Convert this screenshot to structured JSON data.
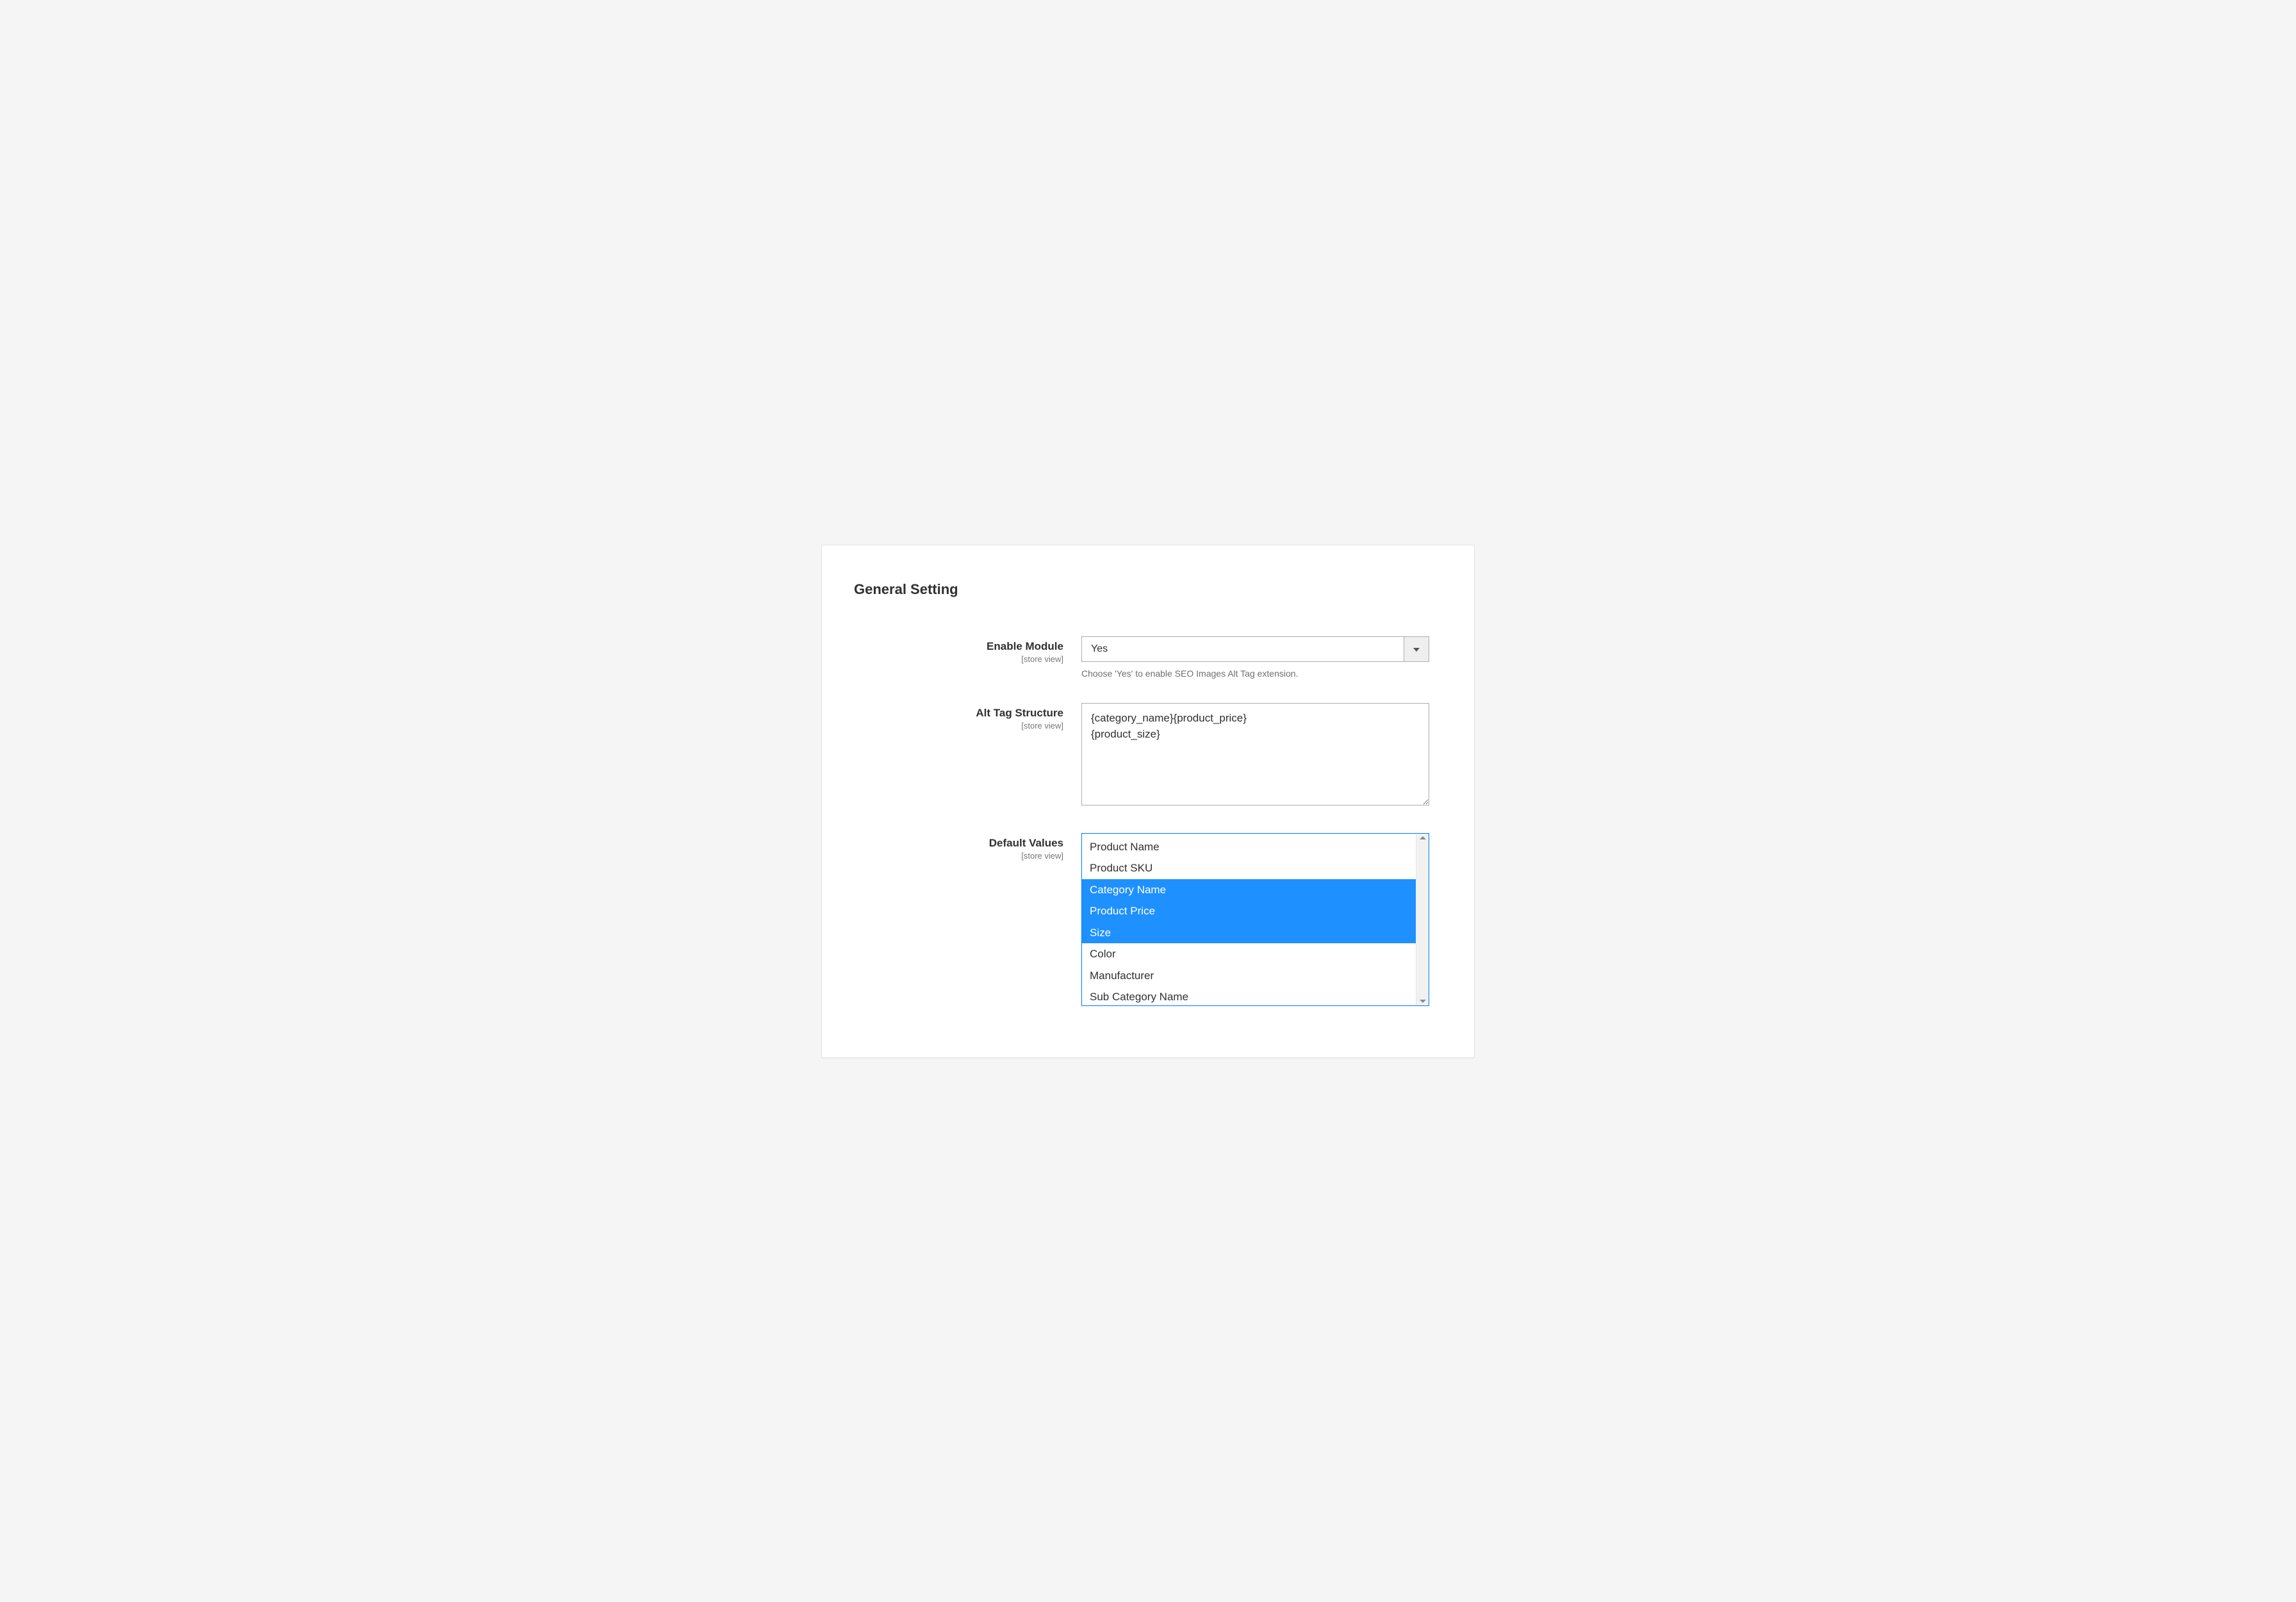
{
  "section": {
    "title": "General Setting"
  },
  "fields": {
    "enable_module": {
      "label": "Enable Module",
      "scope": "[store view]",
      "value": "Yes",
      "help": "Choose 'Yes' to enable SEO Images Alt Tag extension."
    },
    "alt_tag_structure": {
      "label": "Alt Tag Structure",
      "scope": "[store view]",
      "value": "{category_name}{product_price}\n{product_size}"
    },
    "default_values": {
      "label": "Default Values",
      "scope": "[store view]",
      "options": [
        {
          "label": "Product Name",
          "selected": false
        },
        {
          "label": "Product SKU",
          "selected": false
        },
        {
          "label": "Category Name",
          "selected": true
        },
        {
          "label": "Product Price",
          "selected": true
        },
        {
          "label": "Size",
          "selected": true
        },
        {
          "label": "Color",
          "selected": false
        },
        {
          "label": "Manufacturer",
          "selected": false
        },
        {
          "label": "Sub Category Name",
          "selected": false
        }
      ]
    }
  }
}
